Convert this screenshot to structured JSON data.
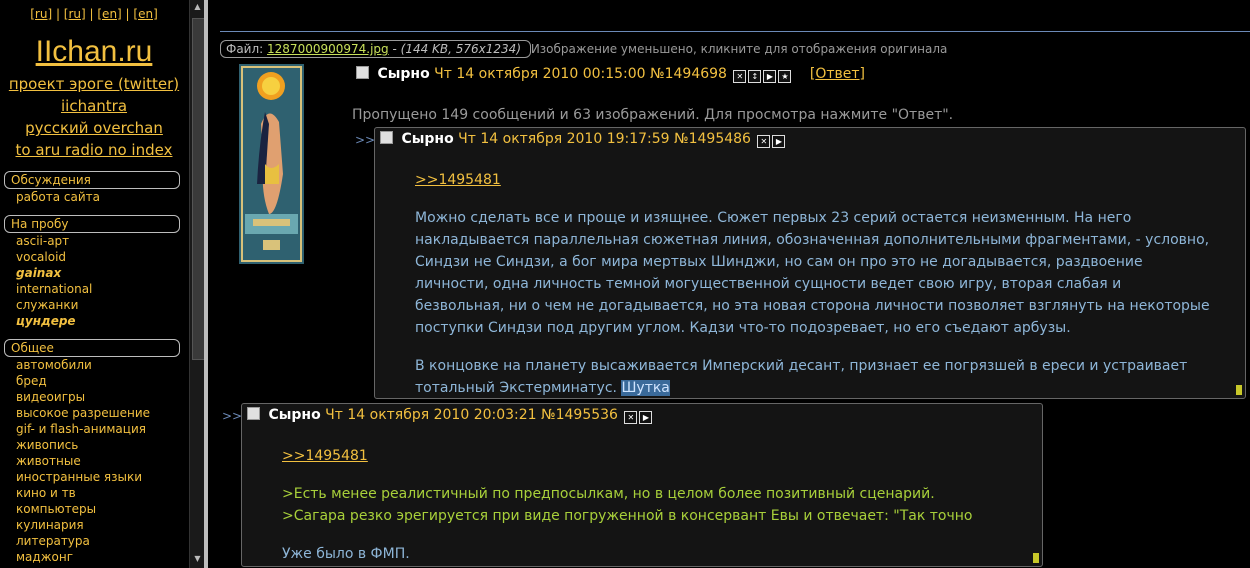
{
  "sidebar": {
    "langs": [
      "[ru]",
      "[ru]",
      "[en]",
      "[en]"
    ],
    "logo": "IIchan.ru",
    "links": [
      "проект эроге (twitter)",
      "iichantra",
      "русский overchan",
      "to aru radio no index"
    ],
    "sections": [
      {
        "title": "Обсуждения",
        "items": [
          {
            "label": "работа сайта",
            "bold": false
          }
        ]
      },
      {
        "title": "На пробу",
        "items": [
          {
            "label": "ascii-арт",
            "bold": false
          },
          {
            "label": "vocaloid",
            "bold": false
          },
          {
            "label": "gainax",
            "bold": true
          },
          {
            "label": "international",
            "bold": false
          },
          {
            "label": "служанки",
            "bold": false
          },
          {
            "label": "цундере",
            "bold": true
          }
        ]
      },
      {
        "title": "Общее",
        "items": [
          {
            "label": "автомобили",
            "bold": false
          },
          {
            "label": "бред",
            "bold": false
          },
          {
            "label": "видеоигры",
            "bold": false
          },
          {
            "label": "высокое разрешение",
            "bold": false
          },
          {
            "label": "gif- и flash-анимация",
            "bold": false
          },
          {
            "label": "живопись",
            "bold": false
          },
          {
            "label": "животные",
            "bold": false
          },
          {
            "label": "иностранные языки",
            "bold": false
          },
          {
            "label": "кино и тв",
            "bold": false
          },
          {
            "label": "компьютеры",
            "bold": false
          },
          {
            "label": "кулинария",
            "bold": false
          },
          {
            "label": "литература",
            "bold": false
          },
          {
            "label": "маджонг",
            "bold": false
          }
        ]
      }
    ]
  },
  "op": {
    "file_label": "Файл:",
    "file_name": "1287000900974.jpg",
    "file_meta": "(144 KB, 576x1234)",
    "file_note": "Изображение уменьшено, кликните для отображения оригинала",
    "name": "Сырно",
    "date": "Чт 14 октября 2010 00:15:00",
    "num": "№1494698",
    "reply_label": "Ответ",
    "skipped": "Пропущено 149 сообщений и 63 изображений. Для просмотра нажмите \"Ответ\"."
  },
  "posts": [
    {
      "arrows": ">>",
      "name": "Сырно",
      "date": "Чт 14 октября 2010 19:17:59",
      "num": "№1495486",
      "quote": ">>1495481",
      "para1": [
        "Можно сделать все и проще и изящнее. Сюжет первых 23 серий остается неизменным. На него",
        "накладывается параллельная сюжетная линия, обозначенная дополнительными фрагментами, - условно,",
        "Синдзи не Синдзи, а бог мира мертвых Шинджи, но сам он про это не догадывается, раздвоение",
        "личности, одна личность темной могущественной сущности ведет свою игру, вторая слабая и",
        "безвольная, ни о чем не догадывается, но эта новая сторона личности позволяет взглянуть на некоторые",
        "поступки Синдзи под другим углом. Кадзи что-то подозревает, но его съедают арбузы."
      ],
      "para2_line1": "В концовке на планету высаживается Имперский десант, признает ее погрязшей в ереси и устраивает",
      "para2_line2": "тотальный Экстерминатус.",
      "para2_highlight": "Шутка"
    },
    {
      "arrows": ">>",
      "name": "Сырно",
      "date": "Чт 14 октября 2010 20:03:21",
      "num": "№1495536",
      "quote": ">>1495481",
      "green1": ">Есть менее реалистичный по предпосылкам, но в целом более позитивный сценарий.",
      "green2": ">Сагара резко эрегируется при виде погруженной в консервант Евы и отвечает: \"Так точно",
      "last": "Уже было в ФМП."
    }
  ],
  "colors": {
    "accent": "#f2c040",
    "text_blue": "#8eb6d8",
    "green": "#a8d03a",
    "bg": "#000000"
  }
}
